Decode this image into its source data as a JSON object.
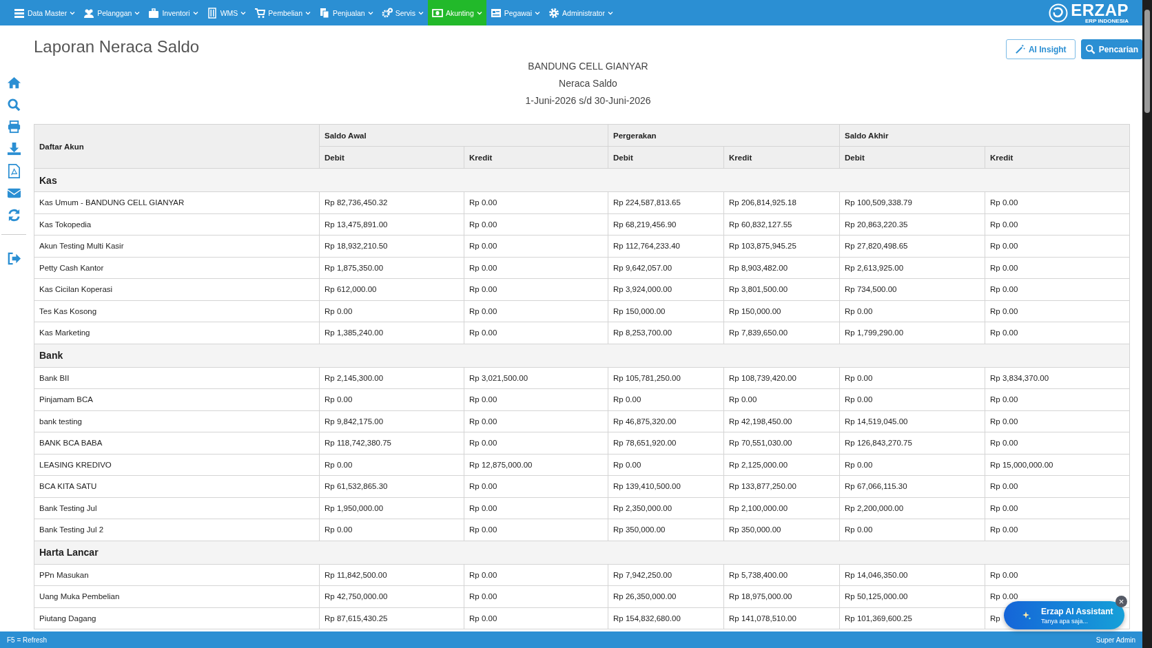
{
  "nav": {
    "items": [
      {
        "label": "Data Master",
        "selected": false
      },
      {
        "label": "Pelanggan",
        "selected": false
      },
      {
        "label": "Inventori",
        "selected": false
      },
      {
        "label": "WMS",
        "selected": false
      },
      {
        "label": "Pembelian",
        "selected": false
      },
      {
        "label": "Penjualan",
        "selected": false
      },
      {
        "label": "Servis",
        "selected": false
      },
      {
        "label": "Akunting",
        "selected": true
      },
      {
        "label": "Pegawai",
        "selected": false
      },
      {
        "label": "Administrator",
        "selected": false
      }
    ],
    "logo": {
      "name": "ERZAP",
      "tagline": "ERP INDONESIA"
    }
  },
  "page": {
    "title": "Laporan Neraca Saldo",
    "buttons": [
      {
        "label": "AI Insight",
        "kind": "outline"
      },
      {
        "label": "Pencarian",
        "kind": "solid"
      }
    ]
  },
  "report": {
    "company": "BANDUNG CELL GIANYAR",
    "name": "Neraca Saldo",
    "period": "1-Juni-2026 s/d 30-Juni-2026"
  },
  "table": {
    "account_column": "Daftar Akun",
    "groups": [
      "Saldo Awal",
      "Pergerakan",
      "Saldo Akhir"
    ],
    "subcolumns": [
      "Debit",
      "Kredit",
      "Debit",
      "Kredit",
      "Debit",
      "Kredit"
    ],
    "sections": [
      {
        "title": "Kas",
        "rows": [
          {
            "account": "Kas Umum - BANDUNG CELL GIANYAR",
            "values": [
              "Rp 82,736,450.32",
              "Rp 0.00",
              "Rp 224,587,813.65",
              "Rp 206,814,925.18",
              "Rp 100,509,338.79",
              "Rp 0.00"
            ]
          },
          {
            "account": "Kas Tokopedia",
            "values": [
              "Rp 13,475,891.00",
              "Rp 0.00",
              "Rp 68,219,456.90",
              "Rp 60,832,127.55",
              "Rp 20,863,220.35",
              "Rp 0.00"
            ]
          },
          {
            "account": "Akun Testing Multi Kasir",
            "values": [
              "Rp 18,932,210.50",
              "Rp 0.00",
              "Rp 112,764,233.40",
              "Rp 103,875,945.25",
              "Rp 27,820,498.65",
              "Rp 0.00"
            ]
          },
          {
            "account": "Petty Cash Kantor",
            "values": [
              "Rp 1,875,350.00",
              "Rp 0.00",
              "Rp 9,642,057.00",
              "Rp 8,903,482.00",
              "Rp 2,613,925.00",
              "Rp 0.00"
            ]
          },
          {
            "account": "Kas Cicilan Koperasi",
            "values": [
              "Rp 612,000.00",
              "Rp 0.00",
              "Rp 3,924,000.00",
              "Rp 3,801,500.00",
              "Rp 734,500.00",
              "Rp 0.00"
            ]
          },
          {
            "account": "Tes Kas Kosong",
            "values": [
              "Rp 0.00",
              "Rp 0.00",
              "Rp 150,000.00",
              "Rp 150,000.00",
              "Rp 0.00",
              "Rp 0.00"
            ]
          },
          {
            "account": "Kas Marketing",
            "values": [
              "Rp 1,385,240.00",
              "Rp 0.00",
              "Rp 8,253,700.00",
              "Rp 7,839,650.00",
              "Rp 1,799,290.00",
              "Rp 0.00"
            ]
          }
        ]
      },
      {
        "title": "Bank",
        "rows": [
          {
            "account": "Bank BII",
            "values": [
              "Rp 2,145,300.00",
              "Rp 3,021,500.00",
              "Rp 105,781,250.00",
              "Rp 108,739,420.00",
              "Rp 0.00",
              "Rp 3,834,370.00"
            ]
          },
          {
            "account": "Pinjamam BCA",
            "values": [
              "Rp 0.00",
              "Rp 0.00",
              "Rp 0.00",
              "Rp 0.00",
              "Rp 0.00",
              "Rp 0.00"
            ]
          },
          {
            "account": "bank testing",
            "values": [
              "Rp 9,842,175.00",
              "Rp 0.00",
              "Rp 46,875,320.00",
              "Rp 42,198,450.00",
              "Rp 14,519,045.00",
              "Rp 0.00"
            ]
          },
          {
            "account": "BANK BCA BABA",
            "values": [
              "Rp 118,742,380.75",
              "Rp 0.00",
              "Rp 78,651,920.00",
              "Rp 70,551,030.00",
              "Rp 126,843,270.75",
              "Rp 0.00"
            ]
          },
          {
            "account": "LEASING KREDIVO",
            "values": [
              "Rp 0.00",
              "Rp 12,875,000.00",
              "Rp 0.00",
              "Rp 2,125,000.00",
              "Rp 0.00",
              "Rp 15,000,000.00"
            ]
          },
          {
            "account": "BCA KITA SATU",
            "values": [
              "Rp 61,532,865.30",
              "Rp 0.00",
              "Rp 139,410,500.00",
              "Rp 133,877,250.00",
              "Rp 67,066,115.30",
              "Rp 0.00"
            ]
          },
          {
            "account": "Bank Testing Jul",
            "values": [
              "Rp 1,950,000.00",
              "Rp 0.00",
              "Rp 2,350,000.00",
              "Rp 2,100,000.00",
              "Rp 2,200,000.00",
              "Rp 0.00"
            ]
          },
          {
            "account": "Bank Testing Jul 2",
            "values": [
              "Rp 0.00",
              "Rp 0.00",
              "Rp 350,000.00",
              "Rp 350,000.00",
              "Rp 0.00",
              "Rp 0.00"
            ]
          }
        ]
      },
      {
        "title": "Harta Lancar",
        "rows": [
          {
            "account": "PPn Masukan",
            "values": [
              "Rp 11,842,500.00",
              "Rp 0.00",
              "Rp 7,942,250.00",
              "Rp 5,738,400.00",
              "Rp 14,046,350.00",
              "Rp 0.00"
            ]
          },
          {
            "account": "Uang Muka Pembelian",
            "values": [
              "Rp 42,750,000.00",
              "Rp 0.00",
              "Rp 26,350,000.00",
              "Rp 18,975,000.00",
              "Rp 50,125,000.00",
              "Rp 0.00"
            ]
          },
          {
            "account": "Piutang Dagang",
            "values": [
              "Rp 87,615,430.25",
              "Rp 0.00",
              "Rp 154,832,680.00",
              "Rp 141,078,510.00",
              "Rp 101,369,600.25",
              "Rp"
            ]
          }
        ]
      }
    ]
  },
  "assistant": {
    "title": "Erzap AI Assistant",
    "subtitle": "Tanya apa saja...",
    "close": "×"
  },
  "status_bar": {
    "left": "F5 = Refresh",
    "right": "Super Admin"
  }
}
